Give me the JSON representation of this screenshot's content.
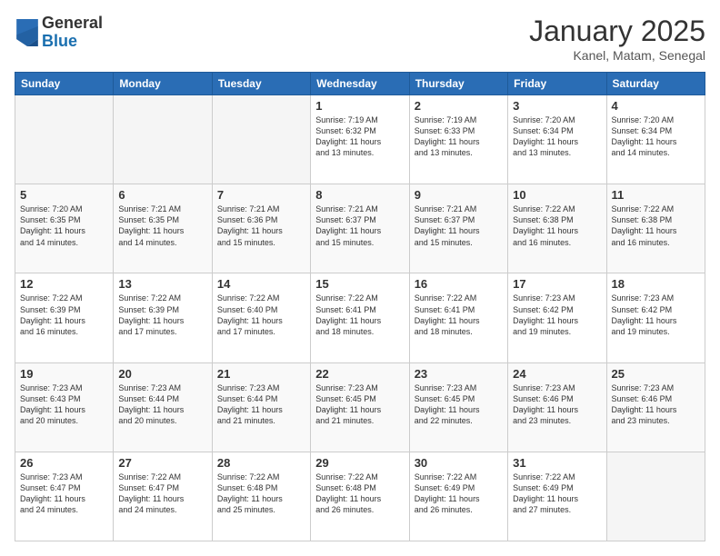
{
  "logo": {
    "general": "General",
    "blue": "Blue"
  },
  "header": {
    "month": "January 2025",
    "location": "Kanel, Matam, Senegal"
  },
  "weekdays": [
    "Sunday",
    "Monday",
    "Tuesday",
    "Wednesday",
    "Thursday",
    "Friday",
    "Saturday"
  ],
  "weeks": [
    [
      {
        "day": null,
        "text": ""
      },
      {
        "day": null,
        "text": ""
      },
      {
        "day": null,
        "text": ""
      },
      {
        "day": 1,
        "text": "Sunrise: 7:19 AM\nSunset: 6:32 PM\nDaylight: 11 hours\nand 13 minutes."
      },
      {
        "day": 2,
        "text": "Sunrise: 7:19 AM\nSunset: 6:33 PM\nDaylight: 11 hours\nand 13 minutes."
      },
      {
        "day": 3,
        "text": "Sunrise: 7:20 AM\nSunset: 6:34 PM\nDaylight: 11 hours\nand 13 minutes."
      },
      {
        "day": 4,
        "text": "Sunrise: 7:20 AM\nSunset: 6:34 PM\nDaylight: 11 hours\nand 14 minutes."
      }
    ],
    [
      {
        "day": 5,
        "text": "Sunrise: 7:20 AM\nSunset: 6:35 PM\nDaylight: 11 hours\nand 14 minutes."
      },
      {
        "day": 6,
        "text": "Sunrise: 7:21 AM\nSunset: 6:35 PM\nDaylight: 11 hours\nand 14 minutes."
      },
      {
        "day": 7,
        "text": "Sunrise: 7:21 AM\nSunset: 6:36 PM\nDaylight: 11 hours\nand 15 minutes."
      },
      {
        "day": 8,
        "text": "Sunrise: 7:21 AM\nSunset: 6:37 PM\nDaylight: 11 hours\nand 15 minutes."
      },
      {
        "day": 9,
        "text": "Sunrise: 7:21 AM\nSunset: 6:37 PM\nDaylight: 11 hours\nand 15 minutes."
      },
      {
        "day": 10,
        "text": "Sunrise: 7:22 AM\nSunset: 6:38 PM\nDaylight: 11 hours\nand 16 minutes."
      },
      {
        "day": 11,
        "text": "Sunrise: 7:22 AM\nSunset: 6:38 PM\nDaylight: 11 hours\nand 16 minutes."
      }
    ],
    [
      {
        "day": 12,
        "text": "Sunrise: 7:22 AM\nSunset: 6:39 PM\nDaylight: 11 hours\nand 16 minutes."
      },
      {
        "day": 13,
        "text": "Sunrise: 7:22 AM\nSunset: 6:39 PM\nDaylight: 11 hours\nand 17 minutes."
      },
      {
        "day": 14,
        "text": "Sunrise: 7:22 AM\nSunset: 6:40 PM\nDaylight: 11 hours\nand 17 minutes."
      },
      {
        "day": 15,
        "text": "Sunrise: 7:22 AM\nSunset: 6:41 PM\nDaylight: 11 hours\nand 18 minutes."
      },
      {
        "day": 16,
        "text": "Sunrise: 7:22 AM\nSunset: 6:41 PM\nDaylight: 11 hours\nand 18 minutes."
      },
      {
        "day": 17,
        "text": "Sunrise: 7:23 AM\nSunset: 6:42 PM\nDaylight: 11 hours\nand 19 minutes."
      },
      {
        "day": 18,
        "text": "Sunrise: 7:23 AM\nSunset: 6:42 PM\nDaylight: 11 hours\nand 19 minutes."
      }
    ],
    [
      {
        "day": 19,
        "text": "Sunrise: 7:23 AM\nSunset: 6:43 PM\nDaylight: 11 hours\nand 20 minutes."
      },
      {
        "day": 20,
        "text": "Sunrise: 7:23 AM\nSunset: 6:44 PM\nDaylight: 11 hours\nand 20 minutes."
      },
      {
        "day": 21,
        "text": "Sunrise: 7:23 AM\nSunset: 6:44 PM\nDaylight: 11 hours\nand 21 minutes."
      },
      {
        "day": 22,
        "text": "Sunrise: 7:23 AM\nSunset: 6:45 PM\nDaylight: 11 hours\nand 21 minutes."
      },
      {
        "day": 23,
        "text": "Sunrise: 7:23 AM\nSunset: 6:45 PM\nDaylight: 11 hours\nand 22 minutes."
      },
      {
        "day": 24,
        "text": "Sunrise: 7:23 AM\nSunset: 6:46 PM\nDaylight: 11 hours\nand 23 minutes."
      },
      {
        "day": 25,
        "text": "Sunrise: 7:23 AM\nSunset: 6:46 PM\nDaylight: 11 hours\nand 23 minutes."
      }
    ],
    [
      {
        "day": 26,
        "text": "Sunrise: 7:23 AM\nSunset: 6:47 PM\nDaylight: 11 hours\nand 24 minutes."
      },
      {
        "day": 27,
        "text": "Sunrise: 7:22 AM\nSunset: 6:47 PM\nDaylight: 11 hours\nand 24 minutes."
      },
      {
        "day": 28,
        "text": "Sunrise: 7:22 AM\nSunset: 6:48 PM\nDaylight: 11 hours\nand 25 minutes."
      },
      {
        "day": 29,
        "text": "Sunrise: 7:22 AM\nSunset: 6:48 PM\nDaylight: 11 hours\nand 26 minutes."
      },
      {
        "day": 30,
        "text": "Sunrise: 7:22 AM\nSunset: 6:49 PM\nDaylight: 11 hours\nand 26 minutes."
      },
      {
        "day": 31,
        "text": "Sunrise: 7:22 AM\nSunset: 6:49 PM\nDaylight: 11 hours\nand 27 minutes."
      },
      {
        "day": null,
        "text": ""
      }
    ]
  ]
}
